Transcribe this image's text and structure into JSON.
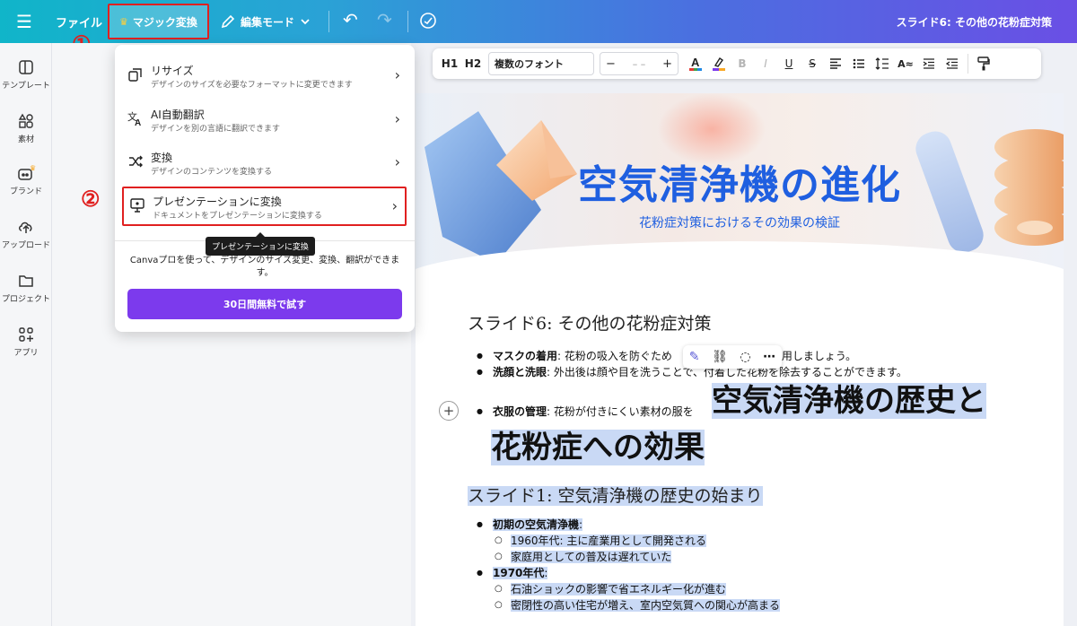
{
  "topbar": {
    "file_label": "ファイル",
    "magic_label": "マジック変換",
    "edit_label": "編集モード",
    "doc_title": "スライド6: その他の花粉症対策"
  },
  "annotations": {
    "one": "①",
    "two": "②"
  },
  "sidebar": {
    "items": [
      {
        "label": "テンプレート",
        "icon": "layout-icon"
      },
      {
        "label": "素材",
        "icon": "shapes-icon"
      },
      {
        "label": "ブランド",
        "icon": "brand-icon"
      },
      {
        "label": "アップロード",
        "icon": "upload-icon"
      },
      {
        "label": "プロジェクト",
        "icon": "folder-icon"
      },
      {
        "label": "アプリ",
        "icon": "apps-icon"
      }
    ]
  },
  "menu": {
    "items": [
      {
        "title": "リサイズ",
        "desc": "デザインのサイズを必要なフォーマットに変更できます",
        "icon": "resize-icon"
      },
      {
        "title": "AI自動翻訳",
        "desc": "デザインを別の言語に翻訳できます",
        "icon": "translate-icon"
      },
      {
        "title": "変換",
        "desc": "デザインのコンテンツを変換する",
        "icon": "shuffle-icon"
      },
      {
        "title": "プレゼンテーションに変換",
        "desc": "ドキュメントをプレゼンテーションに変換する",
        "icon": "presentation-icon"
      }
    ],
    "tooltip": "プレゼンテーションに変換",
    "promo": "Canvaプロを使って、デザインのサイズ変更、変換、翻訳ができます。",
    "trial_button": "30日間無料で試す"
  },
  "text_toolbar": {
    "h1": "H1",
    "h2": "H2",
    "font": "複数のフォント",
    "minus": "−",
    "size": "– –",
    "plus": "+"
  },
  "document": {
    "hero_title": "空気清浄機の進化",
    "hero_subtitle": "花粉症対策におけるその効果の検証",
    "slide6_heading": "スライド6: その他の花粉症対策",
    "slide6_bullets": [
      {
        "bold": "マスクの着用",
        "text": ": 花粉の吸入を防ぐため",
        "tail": "マスクを着用しましょう。"
      },
      {
        "bold": "洗顔と洗眼",
        "text": ": 外出後は顔や目を洗うことで、",
        "tail": "付着した花粉を除去することができます。"
      },
      {
        "bold": "衣服の管理",
        "text": ": 花粉が付きにくい素材の服を"
      }
    ],
    "big_heading_line1": "空気清浄機の歴史と",
    "big_heading_line2": "花粉症への効果",
    "slide1_heading": "スライド1: 空気清浄機の歴史の始まり",
    "slide1_items": [
      {
        "bold": "初期の空気清浄機",
        "suffix": ":",
        "subs": [
          "1960年代: 主に産業用として開発される",
          "家庭用としての普及は遅れていた"
        ]
      },
      {
        "bold": "1970年代",
        "suffix": ":",
        "subs": [
          "石油ショックの影響で省エネルギー化が進む",
          "密閉性の高い住宅が増え、室内空気質への関心が高まる"
        ]
      }
    ]
  }
}
